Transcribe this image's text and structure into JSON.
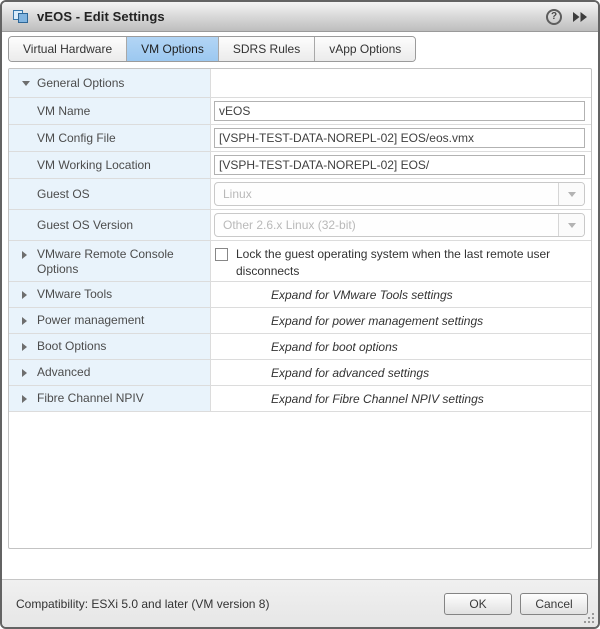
{
  "window": {
    "title": "vEOS - Edit Settings",
    "help_glyph": "?",
    "icons": [
      "vm-icon",
      "help-icon",
      "popout-double-arrow-icon",
      "resize-grip"
    ]
  },
  "tabs": [
    {
      "label": "Virtual Hardware",
      "selected": false
    },
    {
      "label": "VM Options",
      "selected": true
    },
    {
      "label": "SDRS Rules",
      "selected": false
    },
    {
      "label": "vApp Options",
      "selected": false
    }
  ],
  "rows": [
    {
      "type": "section",
      "label": "General Options",
      "expanded": true
    },
    {
      "type": "text",
      "label": "VM Name",
      "value": "vEOS"
    },
    {
      "type": "text",
      "label": "VM Config File",
      "value": "[VSPH-TEST-DATA-NOREPL-02] EOS/eos.vmx"
    },
    {
      "type": "text",
      "label": "VM Working Location",
      "value": "[VSPH-TEST-DATA-NOREPL-02] EOS/"
    },
    {
      "type": "select",
      "label": "Guest OS",
      "value": "Linux",
      "disabled": true
    },
    {
      "type": "select",
      "label": "Guest OS Version",
      "value": "Other 2.6.x Linux (32-bit)",
      "disabled": true
    },
    {
      "type": "checkbox",
      "label": "VMware Remote Console Options",
      "expanded": false,
      "checked": false,
      "value": "Lock the guest operating system when the last remote user disconnects"
    },
    {
      "type": "expander",
      "label": "VMware Tools",
      "note": "Expand for VMware Tools settings"
    },
    {
      "type": "expander",
      "label": "Power management",
      "note": "Expand for power management settings"
    },
    {
      "type": "expander",
      "label": "Boot Options",
      "note": "Expand for boot options"
    },
    {
      "type": "expander",
      "label": "Advanced",
      "note": "Expand for advanced settings"
    },
    {
      "type": "expander",
      "label": "Fibre Channel NPIV",
      "note": "Expand for Fibre Channel NPIV settings"
    }
  ],
  "footer": {
    "compatibility": "Compatibility: ESXi 5.0 and later (VM version 8)",
    "ok_label": "OK",
    "cancel_label": "Cancel"
  },
  "colors": {
    "selected_tab": "#a5cdf2",
    "label_column": "#e9f3fb",
    "dialog_border": "#636363",
    "disabled_text": "#b9b9b9"
  }
}
